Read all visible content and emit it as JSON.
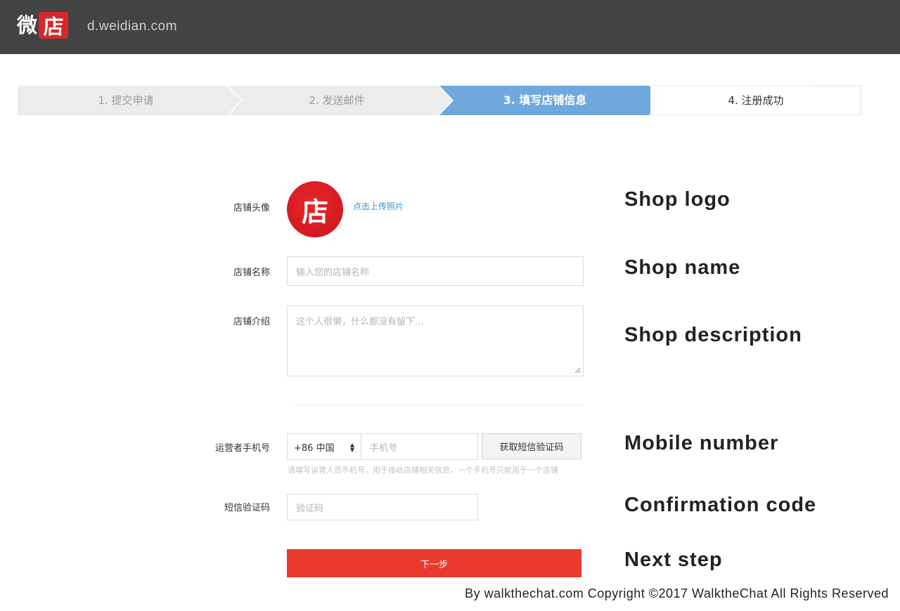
{
  "header": {
    "logo_wei": "微",
    "logo_dian": "店",
    "site_url": "d.weidian.com"
  },
  "steps": [
    {
      "label": "1. 提交申请",
      "state": "done"
    },
    {
      "label": "2. 发送邮件",
      "state": "done"
    },
    {
      "label": "3. 填写店铺信息",
      "state": "active"
    },
    {
      "label": "4. 注册成功",
      "state": "pending"
    }
  ],
  "form": {
    "avatar_label": "店铺头像",
    "avatar_glyph": "店",
    "upload_link": "点击上传照片",
    "name_label": "店铺名称",
    "name_placeholder": "输入您的店铺名称",
    "desc_label": "店铺介绍",
    "desc_placeholder": "这个人很懒，什么都没有留下...",
    "mobile_label": "运营者手机号",
    "country_code": "+86 中国",
    "phone_placeholder": "手机号",
    "sms_button": "获取短信验证码",
    "mobile_hint": "请填写运营人员手机号，用于接收店铺相关信息，一个手机号只能用于一个店铺",
    "code_label": "短信验证码",
    "code_placeholder": "验证码",
    "next_button": "下一步"
  },
  "annotations": {
    "shop_logo": "Shop logo",
    "shop_name": "Shop name",
    "shop_description": "Shop description",
    "mobile_number": "Mobile number",
    "confirmation_code": "Confirmation code",
    "next_step": "Next step"
  },
  "credit": "By walkthechat.com Copyright ©2017 WalktheChat All Rights Reserved",
  "colors": {
    "topbar": "#434343",
    "brand_red": "#d9262c",
    "step_active": "#6fa8dc",
    "step_inactive": "#ececec",
    "next_button": "#ea3a2e",
    "link": "#3b8fc9"
  }
}
